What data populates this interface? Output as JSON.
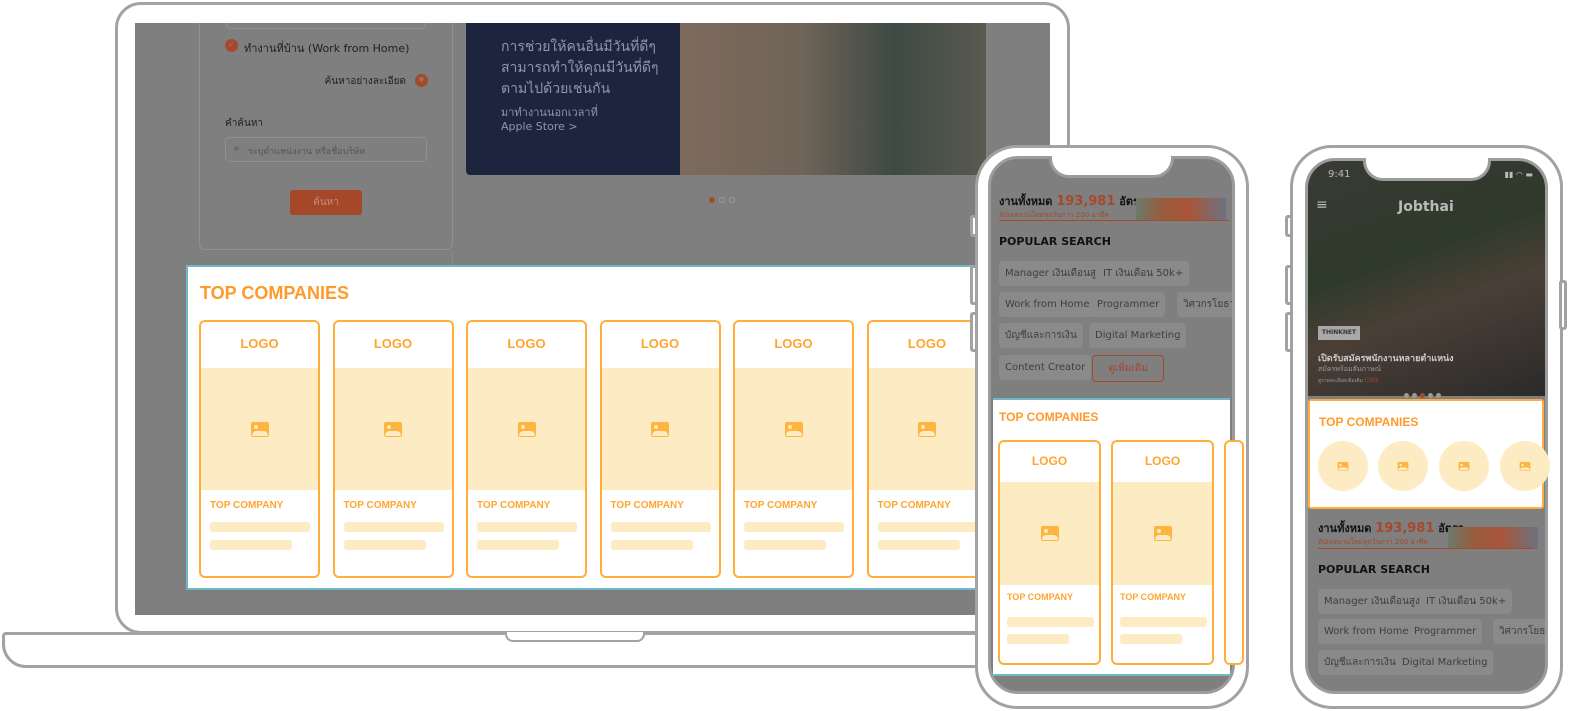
{
  "laptop": {
    "filter_wfh": "ทำงานที่บ้าน (Work from Home)",
    "advanced_search": "ค้นหาอย่างละเอียด",
    "keyword_label": "คำค้นหา",
    "keyword_placeholder": "ระบุตำแหน่งงาน หรือชื่อบริษัท",
    "search_button": "ค้นหา",
    "banner": {
      "headline_1": "การช่วยให้คนอื่นมีวันที่ดีๆ",
      "headline_2": "สามารถทำให้คุณมีวันที่ดีๆ",
      "headline_3": "ตามไปด้วยเช่นกัน",
      "sub_1": "มาทำงานนอกเวลาที่",
      "sub_2": "Apple Store >",
      "slide_count": 3,
      "active_slide": 1
    },
    "top_companies": {
      "title": "TOP COMPANIES",
      "cards": [
        {
          "logo": "LOGO",
          "name": "TOP COMPANY"
        },
        {
          "logo": "LOGO",
          "name": "TOP COMPANY"
        },
        {
          "logo": "LOGO",
          "name": "TOP COMPANY"
        },
        {
          "logo": "LOGO",
          "name": "TOP COMPANY"
        },
        {
          "logo": "LOGO",
          "name": "TOP COMPANY"
        },
        {
          "logo": "LOGO",
          "name": "TOP COMPANY"
        }
      ]
    }
  },
  "phone1": {
    "jobs_prefix": "งานทั้งหมด",
    "jobs_count": "193,981",
    "jobs_suffix": "อัตรา",
    "jobs_sub": "อัปเดตงานใหม่ทุกวันกว่า 200 อาชีพ",
    "popular_title": "POPULAR SEARCH",
    "tags": [
      "Manager เงินเดือนสูง",
      "IT เงินเดือน 50k+",
      "Work from Home",
      "Programmer",
      "วิศวกรโยธา",
      "บัญชีและการเงิน",
      "Digital Marketing",
      "Content Creator"
    ],
    "more": "ดูเพิ่มเติม",
    "top_companies": {
      "title": "TOP COMPANIES",
      "cards": [
        {
          "logo": "LOGO",
          "name": "TOP COMPANY"
        },
        {
          "logo": "LOGO",
          "name": "TOP COMPANY"
        }
      ]
    }
  },
  "phone2": {
    "time": "9:41",
    "brand": "Jobthai",
    "banner_company": "THINKNET",
    "banner_title": "เปิดรับสมัครพนักงานหลายตำแหน่ง",
    "banner_sub": "สมัครพร้อมสัมภาษณ์",
    "banner_link_text": "ดูรายละเอียดเพิ่มเติม",
    "banner_click": "Click",
    "slide_count": 5,
    "active_slide": 3,
    "top_companies_title": "TOP COMPANIES",
    "jobs_prefix": "งานทั้งหมด",
    "jobs_count": "193,981",
    "jobs_suffix": "อัตรา",
    "jobs_sub": "อัปเดตงานใหม่ทุกวันกว่า 200 อาชีพ",
    "popular_title": "POPULAR SEARCH",
    "tags": [
      "Manager เงินเดือนสูง",
      "IT เงินเดือน 50k+",
      "Work from Home",
      "Programmer",
      "วิศวกรโยธา",
      "บัญชีและการเงิน",
      "Digital Marketing"
    ]
  },
  "colors": {
    "accent": "#ff9a2a",
    "placeholder": "#fdecc3",
    "highlight_border": "#6fb8c8",
    "brand_dimmed": "#a8482a"
  }
}
